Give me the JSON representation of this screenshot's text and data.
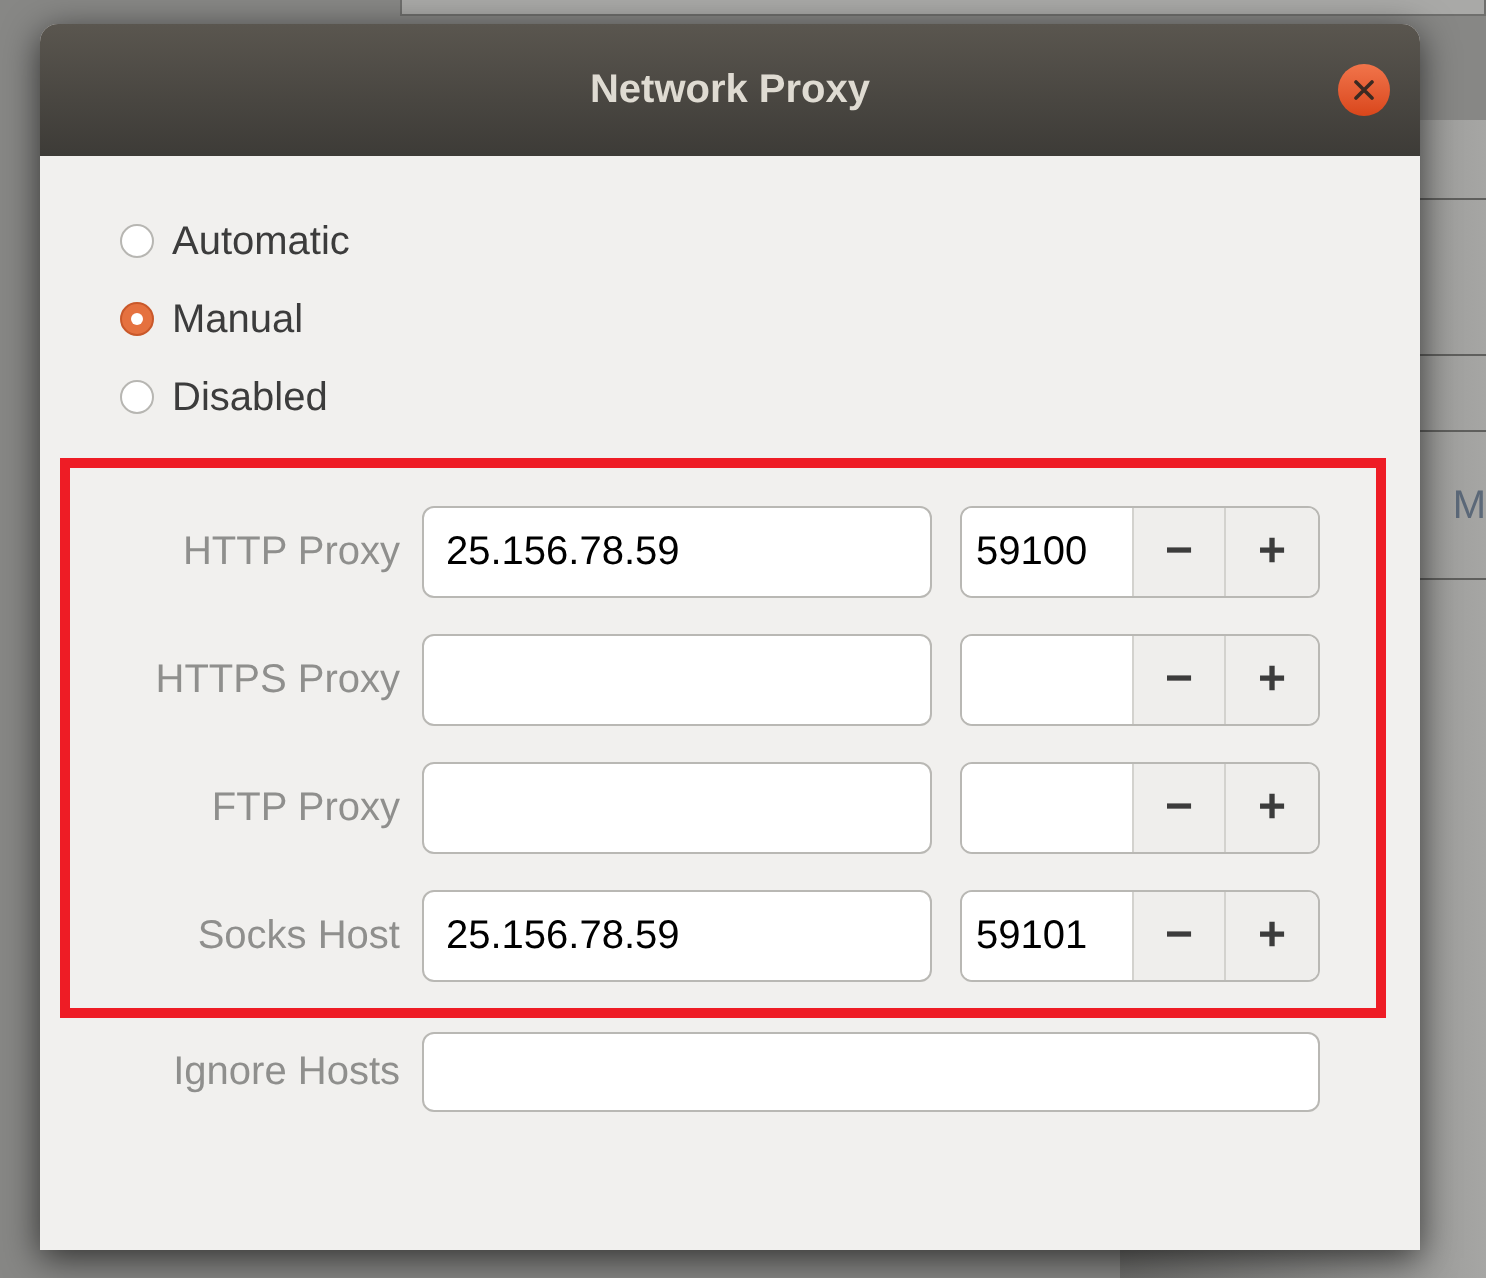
{
  "background": {
    "text": "M"
  },
  "window": {
    "title": "Network Proxy"
  },
  "method_options": [
    {
      "label": "Automatic",
      "selected": false
    },
    {
      "label": "Manual",
      "selected": true
    },
    {
      "label": "Disabled",
      "selected": false
    }
  ],
  "proxies": [
    {
      "label": "HTTP Proxy",
      "host": "25.156.78.59",
      "port": "59100",
      "decrement": "−",
      "increment": "+"
    },
    {
      "label": "HTTPS Proxy",
      "decrement": "−",
      "increment": "+"
    },
    {
      "label": "FTP Proxy",
      "decrement": "−",
      "increment": "+"
    },
    {
      "label": "Socks Host",
      "host": "25.156.78.59",
      "port": "59101",
      "decrement": "−",
      "increment": "+"
    }
  ],
  "ignore_hosts": {
    "label": "Ignore Hosts"
  }
}
